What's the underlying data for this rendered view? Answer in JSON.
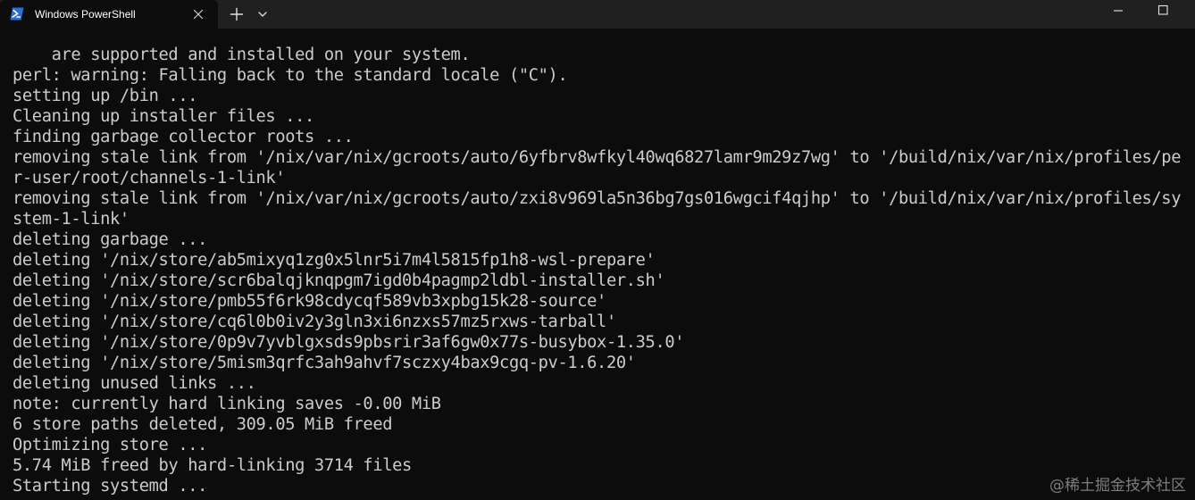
{
  "window": {
    "tab_title": "Windows PowerShell",
    "tab_icon": "powershell-icon",
    "close_tab_icon": "close-icon",
    "new_tab_icon": "plus-icon",
    "dropdown_icon": "chevron-down-icon",
    "minimize_icon": "minimize-icon",
    "maximize_icon": "maximize-icon"
  },
  "colors": {
    "terminal_background": "#0c0c0c",
    "terminal_foreground": "#cccccc",
    "titlebar_background": "#202020",
    "powershell_icon": "#2a6fd1"
  },
  "terminal": {
    "lines": [
      "    are supported and installed on your system.",
      "perl: warning: Falling back to the standard locale (\"C\").",
      "setting up /bin ...",
      "Cleaning up installer files ...",
      "finding garbage collector roots ...",
      "removing stale link from '/nix/var/nix/gcroots/auto/6yfbrv8wfkyl40wq6827lamr9m29z7wg' to '/build/nix/var/nix/profiles/pe",
      "r-user/root/channels-1-link'",
      "removing stale link from '/nix/var/nix/gcroots/auto/zxi8v969la5n36bg7gs016wgcif4qjhp' to '/build/nix/var/nix/profiles/sy",
      "stem-1-link'",
      "deleting garbage ...",
      "deleting '/nix/store/ab5mixyq1zg0x5lnr5i7m4l5815fp1h8-wsl-prepare'",
      "deleting '/nix/store/scr6balqjknqpgm7igd0b4pagmp2ldbl-installer.sh'",
      "deleting '/nix/store/pmb55f6rk98cdycqf589vb3xpbg15k28-source'",
      "deleting '/nix/store/cq6l0b0iv2y3gln3xi6nzxs57mz5rxws-tarball'",
      "deleting '/nix/store/0p9v7yvblgxsds9pbsrir3af6gw0x77s-busybox-1.35.0'",
      "deleting '/nix/store/5mism3qrfc3ah9ahvf7sczxy4bax9cgq-pv-1.6.20'",
      "deleting unused links ...",
      "note: currently hard linking saves -0.00 MiB",
      "6 store paths deleted, 309.05 MiB freed",
      "Optimizing store ...",
      "5.74 MiB freed by hard-linking 3714 files",
      "Starting systemd ..."
    ]
  },
  "watermark": "@稀土掘金技术社区"
}
